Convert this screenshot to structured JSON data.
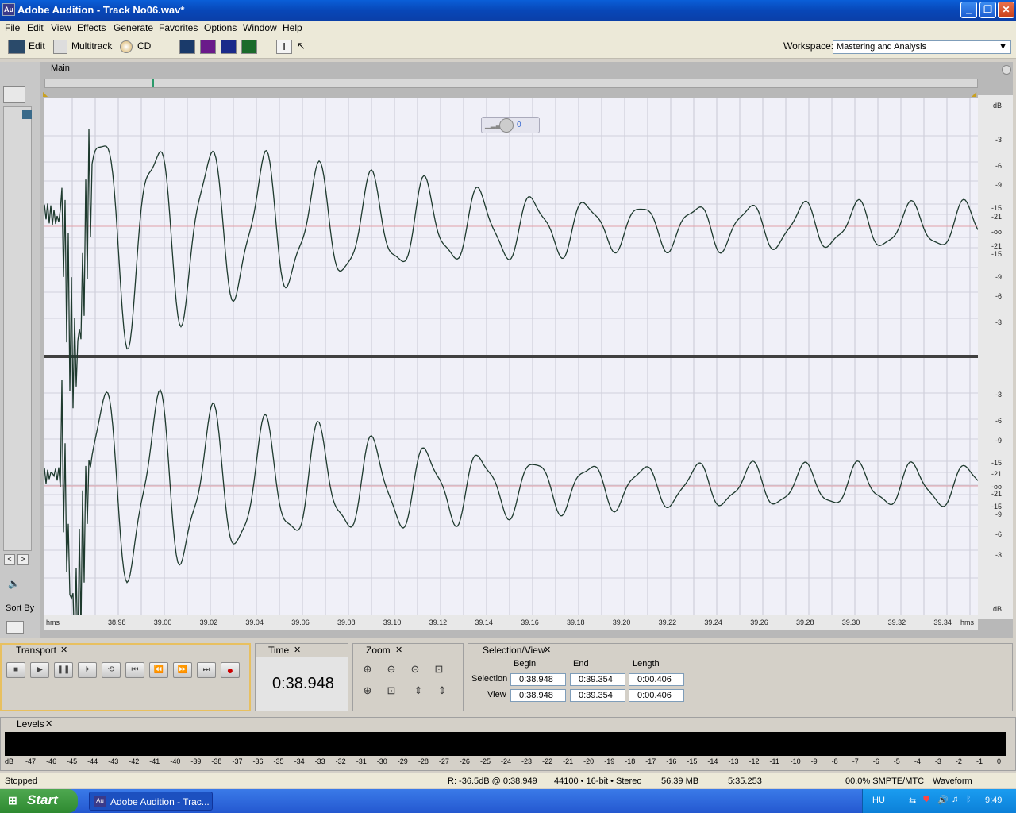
{
  "titlebar": {
    "app_icon": "Au",
    "title": "Adobe Audition - Track No06.wav*"
  },
  "menu": [
    "File",
    "Edit",
    "View",
    "Effects",
    "Generate",
    "Favorites",
    "Options",
    "Window",
    "Help"
  ],
  "toolbar": {
    "edit_label": "Edit",
    "multitrack_label": "Multitrack",
    "cd_label": "CD",
    "workspace_label": "Workspace:",
    "workspace_value": "Mastering and Analysis"
  },
  "main": {
    "tab_label": "Main",
    "volume_value": "0",
    "db_scale_top": [
      "dB",
      "-3",
      "-6",
      "-9",
      "-15",
      "-21",
      "-oo",
      "-21",
      "-15",
      "-9",
      "-6",
      "-3"
    ],
    "db_scale_bottom": [
      "-3",
      "-6",
      "-9",
      "-15",
      "-21",
      "-oo",
      "-21",
      "-15",
      "-9",
      "-6",
      "-3",
      "dB"
    ],
    "time_unit": "hms",
    "time_ticks": [
      "38.98",
      "39.00",
      "39.02",
      "39.04",
      "39.06",
      "39.08",
      "39.10",
      "39.12",
      "39.14",
      "39.16",
      "39.18",
      "39.20",
      "39.22",
      "39.24",
      "39.26",
      "39.28",
      "39.30",
      "39.32",
      "39.34"
    ]
  },
  "sidebar": {
    "sort_label": "Sort By"
  },
  "transport": {
    "tab_label": "Transport"
  },
  "time_panel": {
    "tab_label": "Time",
    "value": "0:38.948"
  },
  "zoom_panel": {
    "tab_label": "Zoom"
  },
  "selection_panel": {
    "tab_label": "Selection/View",
    "col_begin": "Begin",
    "col_end": "End",
    "col_length": "Length",
    "selection_label": "Selection",
    "view_label": "View",
    "sel_begin": "0:38.948",
    "sel_end": "0:39.354",
    "sel_length": "0:00.406",
    "view_begin": "0:38.948",
    "view_end": "0:39.354",
    "view_length": "0:00.406"
  },
  "levels": {
    "tab_label": "Levels",
    "scale": [
      "dB",
      "-47",
      "-46",
      "-45",
      "-44",
      "-43",
      "-42",
      "-41",
      "-40",
      "-39",
      "-38",
      "-37",
      "-36",
      "-35",
      "-34",
      "-33",
      "-32",
      "-31",
      "-30",
      "-29",
      "-28",
      "-27",
      "-26",
      "-25",
      "-24",
      "-23",
      "-22",
      "-21",
      "-20",
      "-19",
      "-18",
      "-17",
      "-16",
      "-15",
      "-14",
      "-13",
      "-12",
      "-11",
      "-10",
      "-9",
      "-8",
      "-7",
      "-6",
      "-5",
      "-4",
      "-3",
      "-2",
      "-1",
      "0"
    ]
  },
  "status": {
    "state": "Stopped",
    "cursor": "R: -36.5dB @   0:38.949",
    "format": "44100 • 16-bit • Stereo",
    "size": "56.39 MB",
    "duration": "5:35.253",
    "time_format": "00.0% SMPTE/MTC",
    "view": "Waveform"
  },
  "taskbar": {
    "start_label": "Start",
    "task_label": "Adobe Audition - Trac...",
    "lang": "HU",
    "clock": "9:49"
  },
  "colors": {
    "wave": "#1e3a2e",
    "wave_bg": "#f0f0f8",
    "accent": "#e8c060"
  }
}
